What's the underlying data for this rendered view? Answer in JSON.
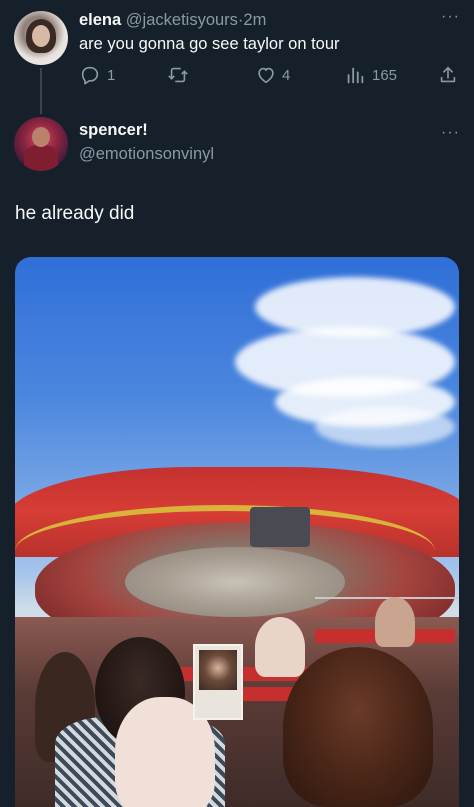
{
  "tweet1": {
    "name": "elena",
    "handle": "@jacketisyours",
    "separator": "·",
    "time": "2m",
    "text": "are you gonna go see taylor on tour",
    "more": "···",
    "actions": {
      "reply_count": "1",
      "retweet_count": "",
      "like_count": "4",
      "views_count": "165"
    }
  },
  "tweet2": {
    "name": "spencer!",
    "handle": "@emotionsonvinyl",
    "more": "···",
    "text": "he already did"
  },
  "colors": {
    "background": "#15202b",
    "text": "#f7f9f9",
    "muted": "#8b98a5"
  }
}
